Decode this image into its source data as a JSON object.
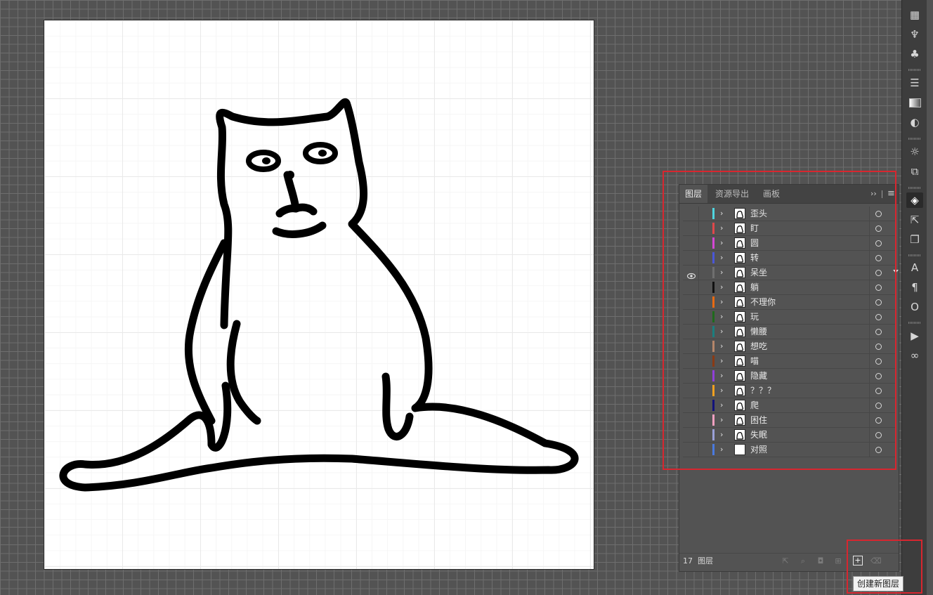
{
  "panel": {
    "tabs": [
      "图层",
      "资源导出",
      "画板"
    ],
    "more_glyph": "››",
    "menu_glyph": "≡"
  },
  "layers": [
    {
      "name": "歪头",
      "color": "#4fd6e0",
      "visible": false
    },
    {
      "name": "盯",
      "color": "#e0484a",
      "visible": false
    },
    {
      "name": "圆",
      "color": "#d447d4",
      "visible": false
    },
    {
      "name": "转",
      "color": "#4a57d8",
      "visible": false
    },
    {
      "name": "呆坐",
      "color": "#6f6f6f",
      "visible": true,
      "selected_target": true
    },
    {
      "name": "躺",
      "color": "#111111",
      "visible": false
    },
    {
      "name": "不理你",
      "color": "#e86a12",
      "visible": false
    },
    {
      "name": "玩",
      "color": "#1f6a1c",
      "visible": false
    },
    {
      "name": "懒腰",
      "color": "#1b7f7f",
      "visible": false
    },
    {
      "name": "想吃",
      "color": "#b5866a",
      "visible": false
    },
    {
      "name": "喵",
      "color": "#8a3a14",
      "visible": false
    },
    {
      "name": "隐藏",
      "color": "#9040d8",
      "visible": false
    },
    {
      "name": "？？？",
      "color": "#f0a020",
      "visible": false
    },
    {
      "name": "爬",
      "color": "#12127a",
      "visible": false
    },
    {
      "name": "困住",
      "color": "#f2a0c0",
      "visible": false
    },
    {
      "name": "失眠",
      "color": "#9aa0d8",
      "visible": false
    },
    {
      "name": "对照",
      "color": "#4a7ae0",
      "visible": false
    }
  ],
  "footer": {
    "count": "17",
    "label": "图层"
  },
  "tooltip": {
    "text": "创建新图层"
  },
  "icons": {
    "toolbar": [
      "libraries-icon",
      "puppet-warp-icon",
      "symbols-icon",
      "stroke-icon",
      "gradient-icon",
      "transparency-icon",
      "appearance-icon",
      "transform-icon",
      "layers-icon",
      "export-icon",
      "artboards-icon",
      "character-icon",
      "paragraph-icon",
      "opentype-icon",
      "actions-icon",
      "links-icon"
    ],
    "footer": [
      "export-selection-icon",
      "locate-object-icon",
      "clipping-mask-icon",
      "new-sublayer-icon",
      "new-layer-icon",
      "delete-icon"
    ]
  }
}
